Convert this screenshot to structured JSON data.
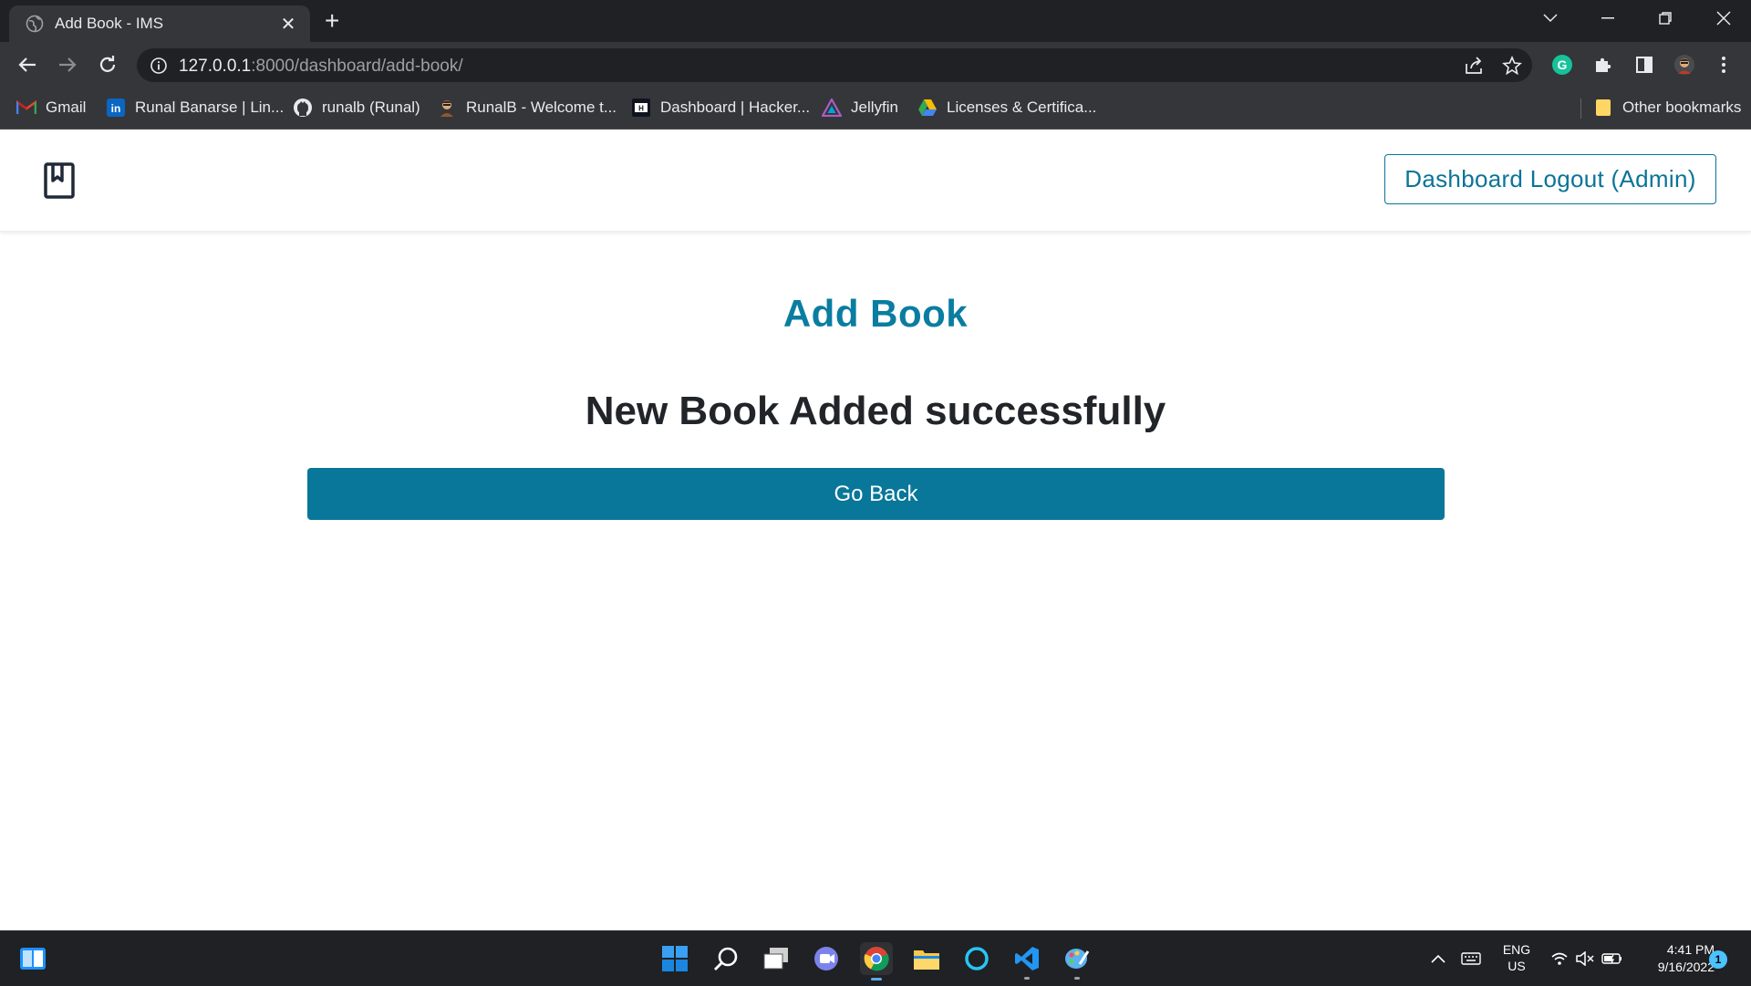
{
  "browser": {
    "tab_title": "Add Book - IMS",
    "url_host": "127.0.0.1",
    "url_rest": ":8000/dashboard/add-book/",
    "bookmarks": [
      {
        "label": "Gmail",
        "icon": "gmail-icon"
      },
      {
        "label": "Runal Banarse | Lin...",
        "icon": "linkedin-icon"
      },
      {
        "label": "runalb (Runal)",
        "icon": "github-icon"
      },
      {
        "label": "RunalB - Welcome t...",
        "icon": "avatar-icon"
      },
      {
        "label": "Dashboard | Hacker...",
        "icon": "hackerrank-icon"
      },
      {
        "label": "Jellyfin",
        "icon": "jellyfin-icon"
      },
      {
        "label": "Licenses & Certifica...",
        "icon": "google-drive-icon"
      }
    ],
    "other_bookmarks": "Other bookmarks"
  },
  "page": {
    "logout_label": "Dashboard Logout (Admin)",
    "title": "Add Book",
    "message": "New Book Added successfully",
    "go_back_label": "Go Back"
  },
  "taskbar": {
    "lang_line1": "ENG",
    "lang_line2": "US",
    "time": "4:41 PM",
    "date": "9/16/2022",
    "notification_count": "1"
  },
  "colors": {
    "accent": "#087799",
    "title": "#0a7da1",
    "text": "#212529"
  }
}
